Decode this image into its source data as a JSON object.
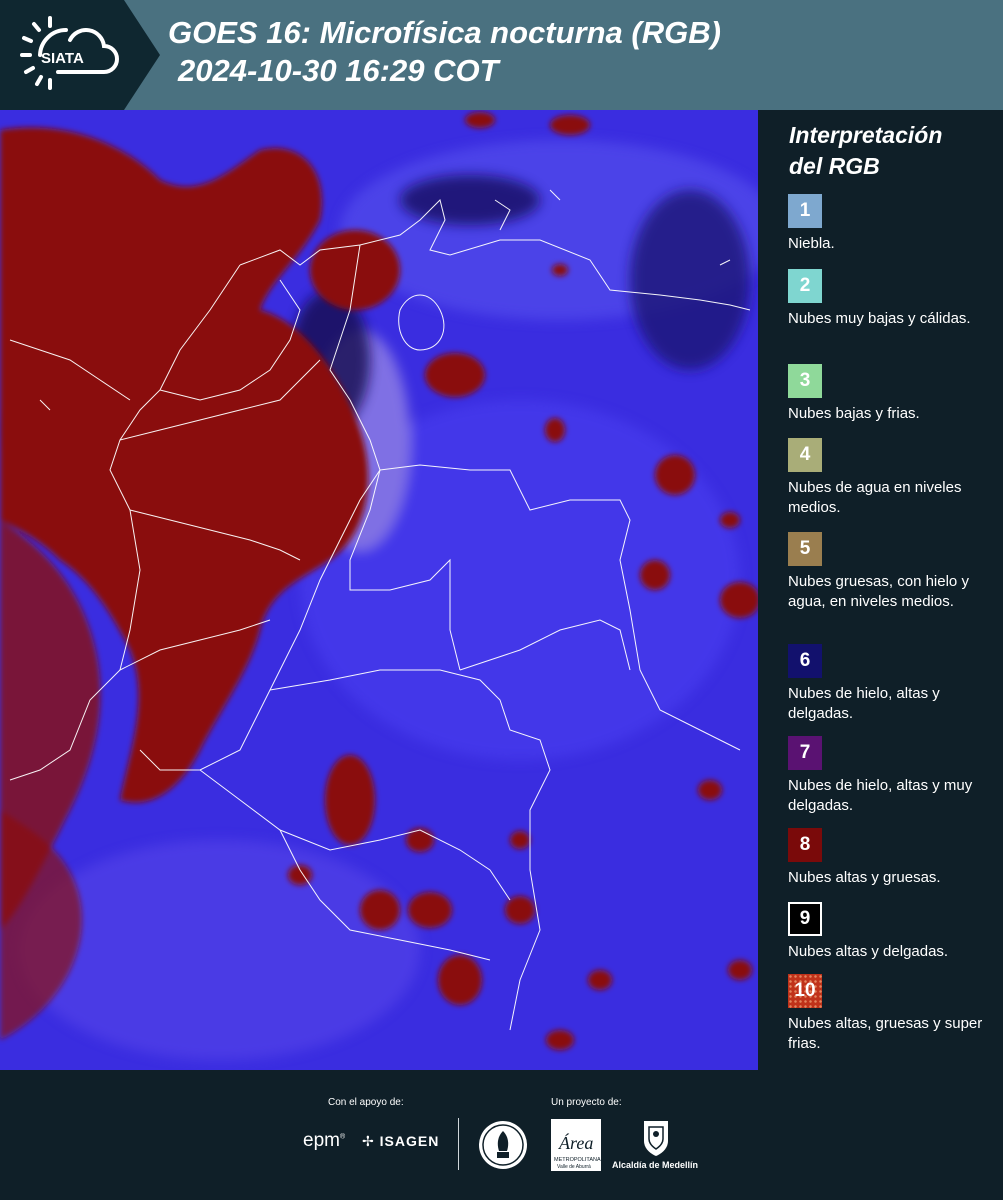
{
  "header": {
    "logo_text": "SIATA",
    "title_line1": "GOES 16: Microfísica nocturna (RGB)",
    "title_line2": "2024-10-30 16:29 COT"
  },
  "legend": {
    "title_line1": "Interpretación",
    "title_line2": "del RGB",
    "items": [
      {
        "number": "1",
        "color": "#7ea8cf",
        "text": "Niebla."
      },
      {
        "number": "2",
        "color": "#7fd6d0",
        "text": "Nubes muy bajas y cálidas."
      },
      {
        "number": "3",
        "color": "#8fd99a",
        "text": "Nubes bajas y frias."
      },
      {
        "number": "4",
        "color": "#a9ad78",
        "text": "Nubes de agua en niveles medios."
      },
      {
        "number": "5",
        "color": "#9a7e4f",
        "text": "Nubes gruesas, con hielo y agua, en niveles medios."
      },
      {
        "number": "6",
        "color": "#12116d",
        "text": "Nubes de hielo, altas y delgadas."
      },
      {
        "number": "7",
        "color": "#5a1272",
        "text": "Nubes de hielo, altas y muy delgadas."
      },
      {
        "number": "8",
        "color": "#7a0a0a",
        "text": "Nubes altas y gruesas."
      },
      {
        "number": "9",
        "color": "#000000",
        "text": "Nubes altas y delgadas."
      },
      {
        "number": "10",
        "color": "#c0321a",
        "text": "Nubes altas, gruesas y super frias."
      }
    ]
  },
  "map": {
    "background_color": "#3a2de0",
    "cloud_color": "#8a0d0d",
    "border_color": "#ffffff"
  },
  "footer": {
    "support_label": "Con el apoyo de:",
    "project_label": "Un proyecto de:",
    "epm_text": "epm",
    "isagen_text": "ISAGEN",
    "area_text": "Área",
    "area_sub1": "METROPOLITANA",
    "area_sub2": "Valle de Aburrá",
    "alcaldia_text": "Alcaldía de Medellín"
  }
}
